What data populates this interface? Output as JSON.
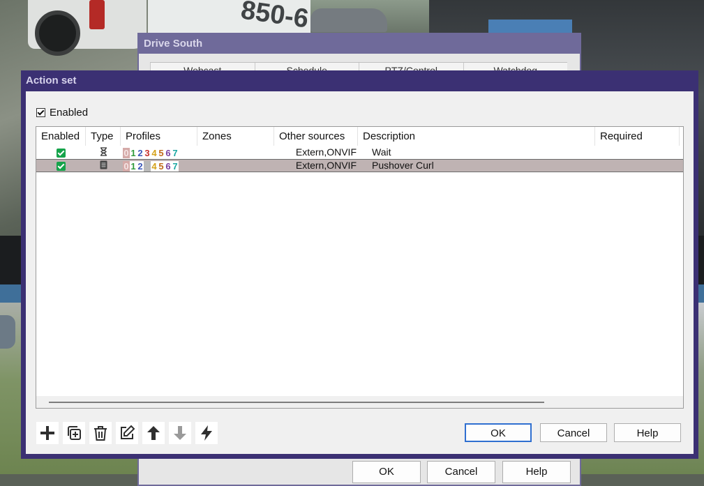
{
  "background_plate_text": "850-6",
  "back_dialog": {
    "title": "Drive South",
    "tabs": [
      "Webcast",
      "Schedule",
      "PTZ/Control",
      "Watchdog"
    ],
    "buttons": {
      "ok": "OK",
      "cancel": "Cancel",
      "help": "Help"
    }
  },
  "dialog": {
    "title": "Action set",
    "enabled_label": "Enabled",
    "enabled_checked": true,
    "columns": [
      "Enabled",
      "Type",
      "Profiles",
      "Zones",
      "Other sources",
      "Description",
      "Required"
    ],
    "profile_digits": [
      "0",
      "1",
      "2",
      "3",
      "4",
      "5",
      "6",
      "7"
    ],
    "profile_colors": [
      "#d5aaa8",
      "#2e9a3a",
      "#3a56b8",
      "#c8302c",
      "#d4a21a",
      "#c06a1a",
      "#7a3fa0",
      "#1aa7a2"
    ],
    "rows": [
      {
        "enabled": true,
        "type_icon": "hourglass-icon",
        "profiles_inactive": [
          0
        ],
        "zones": "",
        "other_sources": "Extern,ONVIF",
        "description": "Wait",
        "required": "",
        "selected": false
      },
      {
        "enabled": true,
        "type_icon": "document-icon",
        "profiles_inactive": [
          0,
          3
        ],
        "zones": "",
        "other_sources": "Extern,ONVIF",
        "description": "Pushover Curl",
        "required": "",
        "selected": true
      }
    ],
    "toolbar": [
      "add-icon",
      "duplicate-icon",
      "delete-icon",
      "edit-icon",
      "move-up-icon",
      "move-down-icon",
      "test-run-icon"
    ],
    "buttons": {
      "ok": "OK",
      "cancel": "Cancel",
      "help": "Help"
    }
  }
}
